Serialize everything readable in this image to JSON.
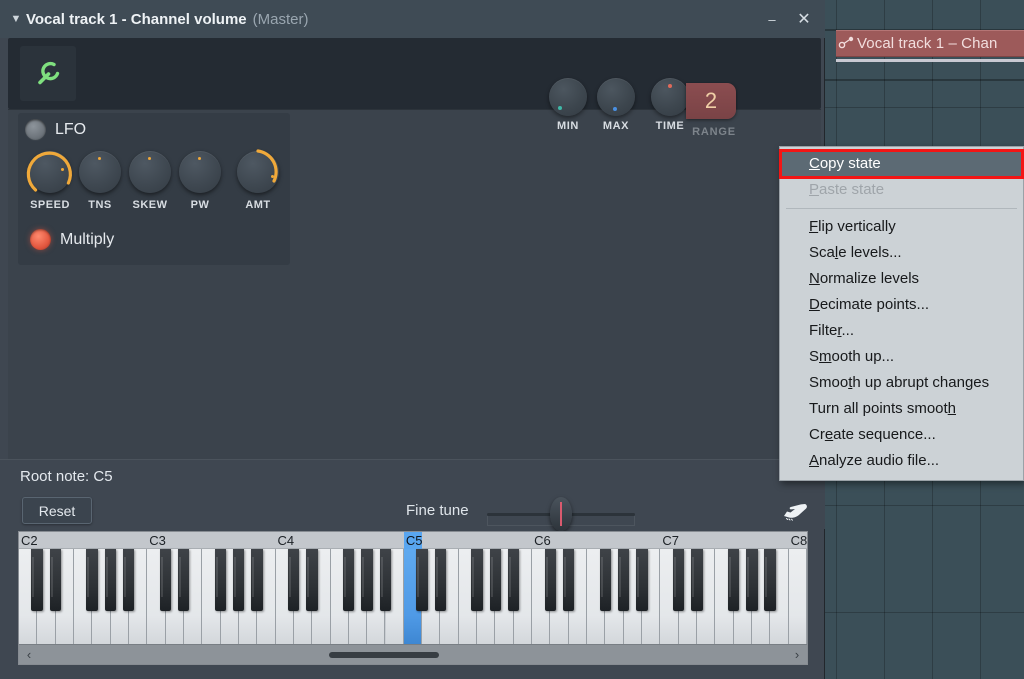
{
  "window": {
    "title": "Vocal track 1 - Channel volume",
    "title_suffix": "(Master)",
    "caret_icon": "chevron-down-icon",
    "minimize_label": "–",
    "close_label": "✕",
    "wrench_icon": "wrench-icon"
  },
  "toolbar": {
    "knobs": [
      {
        "name": "min",
        "label": "MIN",
        "dot_color": "#3fb9a8"
      },
      {
        "name": "max",
        "label": "MAX",
        "dot_color": "#4a90e2"
      },
      {
        "name": "time",
        "label": "TIME",
        "dot_color": "#e06a5a"
      }
    ],
    "range": {
      "label": "RANGE",
      "value": "2"
    }
  },
  "lfo": {
    "toggle_label": "LFO",
    "toggle_state": "off",
    "knobs": [
      {
        "name": "speed",
        "label": "SPEED",
        "value": 0.62
      },
      {
        "name": "tns",
        "label": "TNS",
        "value": 0.5
      },
      {
        "name": "skew",
        "label": "SKEW",
        "value": 0.5
      },
      {
        "name": "pw",
        "label": "PW",
        "value": 0.5
      },
      {
        "name": "amt",
        "label": "AMT",
        "value": 0.78
      }
    ],
    "multiply_label": "Multiply",
    "multiply_state": "on"
  },
  "bottom": {
    "root_note_label": "Root note: C5",
    "reset_label": "Reset",
    "fine_tune_label": "Fine tune",
    "fine_tune_value": 0.5,
    "hand_icon": "hand-pointer-icon"
  },
  "keyboard": {
    "root_note": "C5",
    "octaves": [
      "C2",
      "C3",
      "C4",
      "C5",
      "C6",
      "C7",
      "C8"
    ],
    "scroll_left_icon": "chevron-left-icon",
    "scroll_right_icon": "chevron-right-icon"
  },
  "context_menu": {
    "accent_color": "#f41515",
    "items": [
      {
        "label": "Copy state",
        "accel": "C",
        "state": "highlighted"
      },
      {
        "label": "Paste state",
        "accel": "P",
        "state": "disabled"
      },
      {
        "separator": true
      },
      {
        "label": "Flip vertically",
        "accel": "F",
        "state": "normal"
      },
      {
        "label": "Scale levels...",
        "accel": "l",
        "state": "normal"
      },
      {
        "label": "Normalize levels",
        "accel": "N",
        "state": "normal"
      },
      {
        "label": "Decimate points...",
        "accel": "D",
        "state": "normal"
      },
      {
        "label": "Filter...",
        "accel": "r",
        "state": "normal"
      },
      {
        "label": "Smooth up...",
        "accel": "m",
        "state": "normal"
      },
      {
        "label": "Smooth up abrupt changes",
        "accel": "t",
        "state": "normal"
      },
      {
        "label": "Turn all points smooth",
        "accel": "h",
        "state": "normal"
      },
      {
        "label": "Create sequence...",
        "accel": "e",
        "state": "normal"
      },
      {
        "label": "Analyze audio file...",
        "accel": "A",
        "state": "normal"
      }
    ]
  },
  "background": {
    "clip_title": "Vocal track 1 – Chan",
    "clip_icon": "automation-clip-icon"
  }
}
